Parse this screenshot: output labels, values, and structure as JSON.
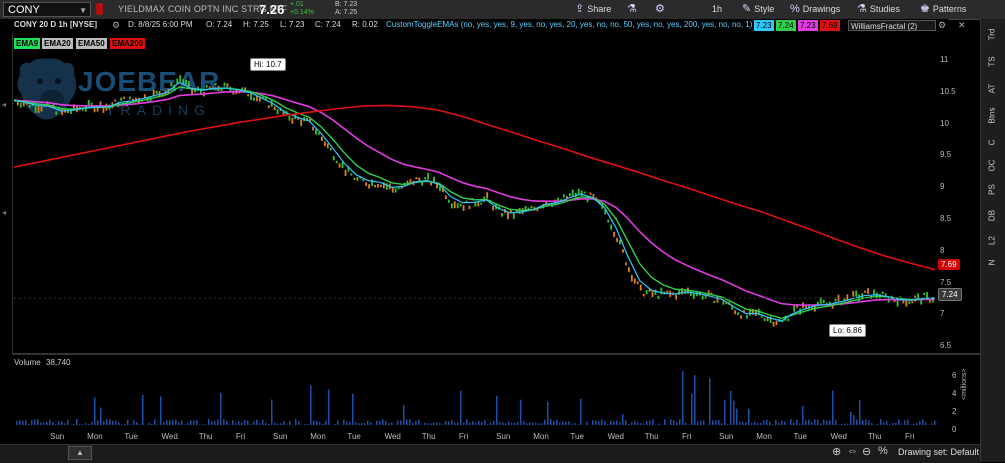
{
  "toolbar": {
    "symbol": "CONY",
    "description": "YIELDMAX COIN OPTN INC STRG ETF",
    "last": "7.26",
    "change": "+.01",
    "change_pct": "+0.14%",
    "bid": "B: 7.23",
    "ask": "A: 7.25",
    "share_label": "Share",
    "timeframe": "1h",
    "style_label": "Style",
    "drawings_label": "Drawings",
    "studies_label": "Studies",
    "patterns_label": "Patterns"
  },
  "infobar": {
    "chart_id": "CONY 20 D 1h [NYSE]",
    "date": "D: 8/8/25 6:00 PM",
    "open": "O: 7.24",
    "high": "H: 7.25",
    "low": "L: 7.23",
    "close": "C: 7.24",
    "range": "R: 0.02",
    "study_label": "CustomToggleEMAs (no, yes, yes, 9, yes, no, yes, 20, yes, no, no, 50, yes, no, yes, 200, yes, no, no, 1)",
    "study_values": [
      {
        "text": "7.23",
        "color": "#2fc7ff"
      },
      {
        "text": "7.24",
        "color": "#2fd14a"
      },
      {
        "text": "7.23",
        "color": "#e03ce0"
      },
      {
        "text": "7.69",
        "color": "#e01010"
      }
    ],
    "williams": "WilliamsFractal (2)"
  },
  "ema_legend": [
    {
      "label": "EMA9",
      "bg": "#1fe05a",
      "fg": "#000"
    },
    {
      "label": "EMA20",
      "bg": "#bbbbbb",
      "fg": "#000"
    },
    {
      "label": "EMA50",
      "bg": "#bbbbbb",
      "fg": "#000"
    },
    {
      "label": "EMA200",
      "bg": "#e01010",
      "fg": "#000"
    }
  ],
  "watermark": {
    "brand": "JOEBEAR",
    "sub": "TRADING"
  },
  "sidebar": [
    "Trd",
    "TS",
    "AT",
    "Btns",
    "C",
    "OC",
    "PS",
    "DB",
    "L2",
    "N"
  ],
  "price_axis": [
    "11",
    "10.5",
    "10",
    "9.5",
    "9",
    "8.5",
    "8",
    "7.5",
    "7",
    "6.5"
  ],
  "tags": {
    "hi": "Hi: 10.7",
    "lo": "Lo: 6.86",
    "ema200": "7.69",
    "last": "7.24"
  },
  "volume": {
    "label": "Volume",
    "value": "38,740",
    "axis": [
      "6",
      "4",
      "2",
      "0"
    ],
    "unit": "<millions>"
  },
  "day_labels": [
    "Sun",
    "Mon",
    "Tue",
    "Wed",
    "Thu",
    "Fri",
    "Sun",
    "Mon",
    "Tue",
    "Wed",
    "Thu",
    "Fri",
    "Sun",
    "Mon",
    "Tue",
    "Wed",
    "Thu",
    "Fri",
    "Sun",
    "Mon",
    "Tue",
    "Wed",
    "Thu",
    "Fri"
  ],
  "bottom": {
    "drawing_set": "Drawing set: Default"
  },
  "chart_data": {
    "type": "line",
    "title": "CONY 20 D 1h [NYSE]",
    "ylim": [
      6.5,
      11.1
    ],
    "series": [
      {
        "name": "EMA9",
        "color": "#2fc7ff"
      },
      {
        "name": "EMA20",
        "color": "#2fd14a"
      },
      {
        "name": "EMA50",
        "color": "#e03ce0"
      },
      {
        "name": "EMA200",
        "color": "#e01010"
      }
    ],
    "price_path": [
      10.35,
      10.3,
      10.25,
      10.25,
      10.15,
      10.2,
      10.25,
      10.25,
      10.25,
      10.35,
      10.35,
      10.4,
      10.45,
      10.5,
      10.7,
      10.5,
      10.5,
      10.55,
      10.55,
      10.5,
      10.45,
      10.35,
      10.25,
      10.1,
      10.05,
      10.0,
      9.75,
      9.5,
      9.25,
      9.1,
      9.05,
      9.05,
      8.95,
      9.0,
      9.1,
      9.1,
      9.0,
      8.75,
      8.7,
      8.75,
      8.8,
      8.6,
      8.55,
      8.6,
      8.65,
      8.75,
      8.75,
      8.85,
      8.9,
      8.8,
      8.6,
      8.2,
      7.7,
      7.35,
      7.3,
      7.3,
      7.3,
      7.35,
      7.3,
      7.25,
      7.2,
      7.05,
      6.95,
      7.0,
      6.9,
      6.86,
      7.05,
      7.1,
      7.15,
      7.15,
      7.2,
      7.25,
      7.3,
      7.3,
      7.25,
      7.2,
      7.2,
      7.25,
      7.24
    ],
    "ema200": [
      9.3,
      9.38,
      9.46,
      9.54,
      9.62,
      9.7,
      9.78,
      9.86,
      9.93,
      10.0,
      10.06,
      10.12,
      10.17,
      10.22,
      10.26,
      10.27,
      10.25,
      10.2,
      10.1,
      9.97,
      9.85,
      9.72,
      9.6,
      9.47,
      9.35,
      9.23,
      9.1,
      8.98,
      8.85,
      8.72,
      8.6,
      8.46,
      8.32,
      8.17,
      8.03,
      7.9,
      7.79,
      7.69
    ]
  }
}
